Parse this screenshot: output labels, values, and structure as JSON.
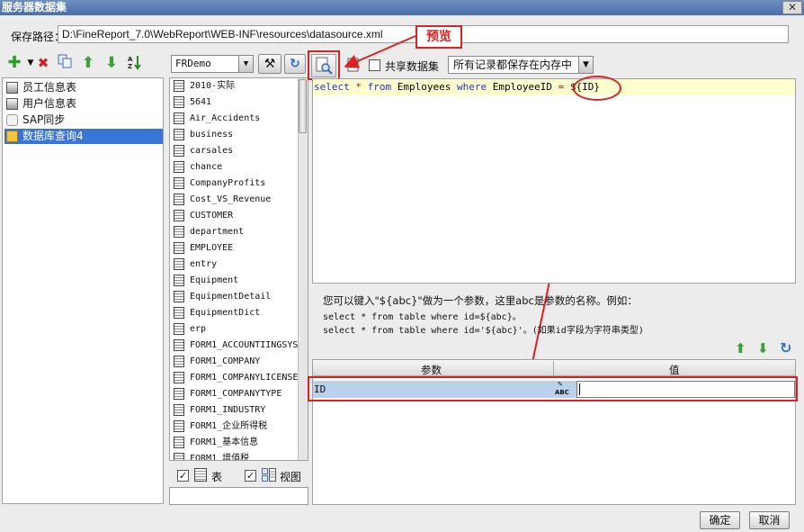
{
  "window": {
    "title": "服务器数据集",
    "close": "✕"
  },
  "path": {
    "label": "保存路径：",
    "value": "D:\\FineReport_7.0\\WebReport\\WEB-INF\\resources\\datasource.xml"
  },
  "datasets": [
    {
      "name": "员工信息表"
    },
    {
      "name": "用户信息表"
    },
    {
      "name": "SAP同步"
    },
    {
      "name": "数据库查询4",
      "selected": true
    }
  ],
  "db": {
    "selected": "FRDemo"
  },
  "tables": [
    "2010-实际",
    "5641",
    "Air_Accidents",
    "business",
    "carsales",
    "chance",
    "CompanyProfits",
    "Cost_VS_Revenue",
    "CUSTOMER",
    "department",
    "EMPLOYEE",
    "entry",
    "Equipment",
    "EquipmentDetail",
    "EquipmentDict",
    "erp",
    "FORM1_ACCOUNTIINGSYS",
    "FORM1_COMPANY",
    "FORM1_COMPANYLICENSE",
    "FORM1_COMPANYTYPE",
    "FORM1_INDUSTRY",
    "FORM1_企业所得税",
    "FORM1_基本信息",
    "FORM1_增值税"
  ],
  "filters": {
    "table_label": "表",
    "view_label": "视图"
  },
  "toolbar": {
    "share_label": "共享数据集",
    "memory_option": "所有记录都保存在内存中"
  },
  "sql": {
    "kw_select": "select",
    "op_star": "*",
    "kw_from": "from",
    "table": "Employees",
    "kw_where": "where",
    "col": "EmployeeID",
    "op_eq": "=",
    "param": "${ID}"
  },
  "hint": {
    "line1": "您可以键入\"${abc}\"做为一个参数，这里abc是参数的名称。例如：",
    "line2": "select * from table where id=${abc}。",
    "line3": "select * from table where id='${abc}'。(如果id字段为字符串类型)"
  },
  "params": {
    "col_param": "参数",
    "col_value": "值",
    "rows": [
      {
        "name": "ID",
        "type_icon": "ABC",
        "value": ""
      }
    ]
  },
  "callout": {
    "label": "预览"
  },
  "buttons": {
    "ok": "确定",
    "cancel": "取消"
  }
}
